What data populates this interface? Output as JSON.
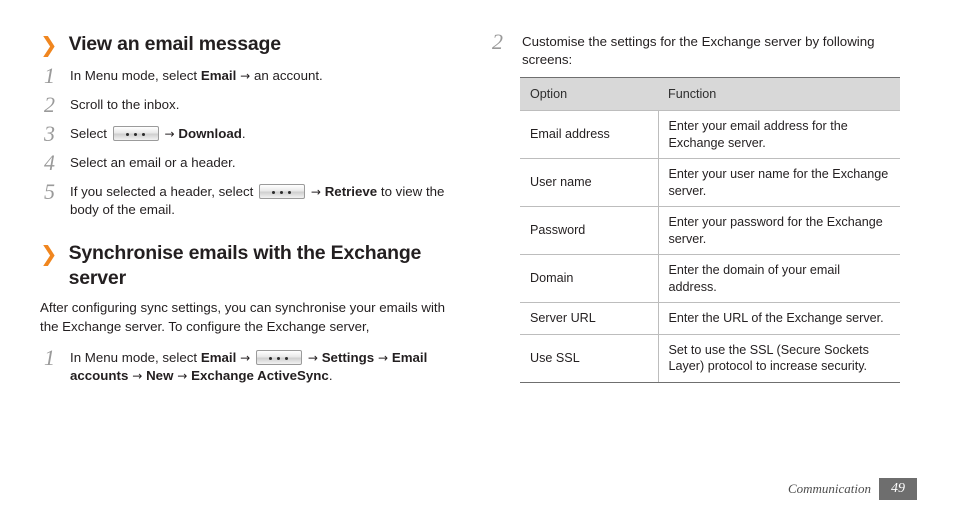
{
  "left": {
    "section1": {
      "chevron": "❯",
      "title": "View an email message",
      "steps": [
        {
          "num": "1",
          "html_id": "s1",
          "text_a": "In Menu mode, select ",
          "bold_a": "Email",
          "arrow1": " → ",
          "text_b": "an account."
        },
        {
          "num": "2",
          "text_a": "Scroll to the inbox."
        },
        {
          "num": "3",
          "text_a": "Select ",
          "icon": "options-key-icon",
          "arrow1": " → ",
          "bold_a": "Download",
          "text_b": "."
        },
        {
          "num": "4",
          "text_a": "Select an email or a header."
        },
        {
          "num": "5",
          "text_a": "If you selected a header, select ",
          "icon": "options-key-icon",
          "arrow1": " → ",
          "bold_a": "Retrieve",
          "text_b": " to view the body of the email."
        }
      ]
    },
    "section2": {
      "chevron": "❯",
      "title": "Synchronise emails with the Exchange server",
      "paragraph": "After configuring sync settings, you can synchronise your emails with the Exchange server. To configure the Exchange server,",
      "step1": {
        "num": "1",
        "t1": "In Menu mode, select ",
        "b1": "Email",
        "a1": " → ",
        "icon": "options-key-icon",
        "a2": " → ",
        "b2": "Settings",
        "a3": " → ",
        "b3": "Email accounts",
        "a4": " → ",
        "b4": "New",
        "a5": " → ",
        "b5": "Exchange ActiveSync",
        "t2": "."
      }
    }
  },
  "right": {
    "step": {
      "num": "2",
      "text": "Customise the settings for the Exchange server by following screens:"
    },
    "table": {
      "headers": [
        "Option",
        "Function"
      ],
      "rows": [
        {
          "option": "Email address",
          "function": "Enter your email address for the Exchange server."
        },
        {
          "option": "User name",
          "function": "Enter your user name for the Exchange server."
        },
        {
          "option": "Password",
          "function": "Enter your password for the Exchange server."
        },
        {
          "option": "Domain",
          "function": "Enter the domain of your email address."
        },
        {
          "option": "Server URL",
          "function": "Enter the URL of the Exchange server."
        },
        {
          "option": "Use SSL",
          "function": "Set to use the SSL (Secure Sockets Layer) protocol to increase security."
        }
      ]
    }
  },
  "footer": {
    "chapter": "Communication",
    "page": "49"
  },
  "colors": {
    "accent": "#f0861f",
    "header_bg": "#d8d8d8",
    "step_num": "#9a9a9a",
    "footer_badge": "#6e6e6e"
  }
}
